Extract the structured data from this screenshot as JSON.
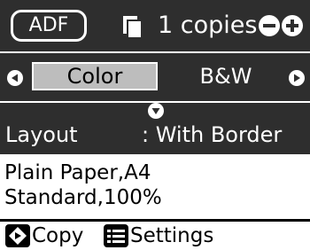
{
  "top_bar": {
    "source_badge": "ADF",
    "copies_text": "1 copies",
    "copies_icon": "copies-icon",
    "minus_icon": "minus-icon",
    "plus_icon": "plus-icon"
  },
  "mode_selector": {
    "options": [
      "Color",
      "B&W"
    ],
    "selected": "Color",
    "left_icon": "left-arrow-icon",
    "right_icon": "right-arrow-icon"
  },
  "layout": {
    "label": "Layout",
    "value": ": With Border",
    "indicator_icon": "down-arrow-icon"
  },
  "info": {
    "line1": "Plain Paper,A4",
    "line2": "Standard,100%"
  },
  "bottom_bar": {
    "copy_label": "Copy",
    "settings_label": "Settings",
    "start_icon": "start-icon",
    "menu_icon": "menu-icon"
  },
  "colors": {
    "panel_dark": "#2e2e2e",
    "highlight": "#bdbdbd",
    "text_light": "#ffffff",
    "text_dark": "#000000"
  }
}
